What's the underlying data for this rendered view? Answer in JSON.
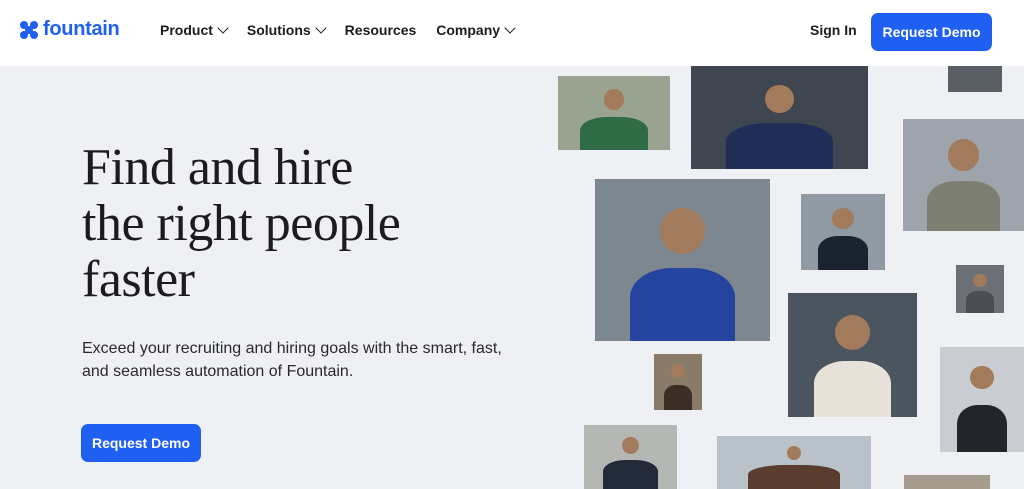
{
  "brand": {
    "name": "fountain",
    "color": "#1f5ff2"
  },
  "nav": {
    "items": [
      {
        "label": "Product",
        "has_dropdown": true
      },
      {
        "label": "Solutions",
        "has_dropdown": true
      },
      {
        "label": "Resources",
        "has_dropdown": false
      },
      {
        "label": "Company",
        "has_dropdown": true
      }
    ],
    "sign_in": "Sign In",
    "cta": "Request Demo"
  },
  "hero": {
    "headline_lines": [
      "Find and hire",
      "the right people",
      "faster"
    ],
    "subtext_lines": [
      "Exceed your recruiting and hiring goals with the smart, fast,",
      "and seamless automation of Fountain."
    ],
    "cta": "Request Demo"
  },
  "photos": [
    {
      "name": "photo-grocery-worker",
      "bg": "#9aa38f",
      "fg": "#2f6b45"
    },
    {
      "name": "photo-mechanic",
      "bg": "#3f4650",
      "fg": "#1f2d57"
    },
    {
      "name": "photo-top-small",
      "bg": "#5a5f66",
      "fg": "#2b2f35"
    },
    {
      "name": "photo-warehouse-tablet",
      "bg": "#9ea4ab",
      "fg": "#7d7f73"
    },
    {
      "name": "photo-warehouse-worker",
      "bg": "#7d8790",
      "fg": "#2444a0"
    },
    {
      "name": "photo-delivery-worker",
      "bg": "#8f9aa3",
      "fg": "#1b2330"
    },
    {
      "name": "photo-cashier",
      "bg": "#6b6f76",
      "fg": "#4a4d53"
    },
    {
      "name": "photo-cook",
      "bg": "#4a5560",
      "fg": "#e6e2da"
    },
    {
      "name": "photo-small-portrait",
      "bg": "#8a7a68",
      "fg": "#3a2e27"
    },
    {
      "name": "photo-restaurant-server",
      "bg": "#c9cdd1",
      "fg": "#22262b"
    },
    {
      "name": "photo-older-worker",
      "bg": "#b5b7b4",
      "fg": "#222a3a"
    },
    {
      "name": "photo-man-bottom",
      "bg": "#b9c2c9",
      "fg": "#5a3d2e"
    },
    {
      "name": "photo-bottom-right",
      "bg": "#a59c8e",
      "fg": "#3b2f26"
    }
  ]
}
